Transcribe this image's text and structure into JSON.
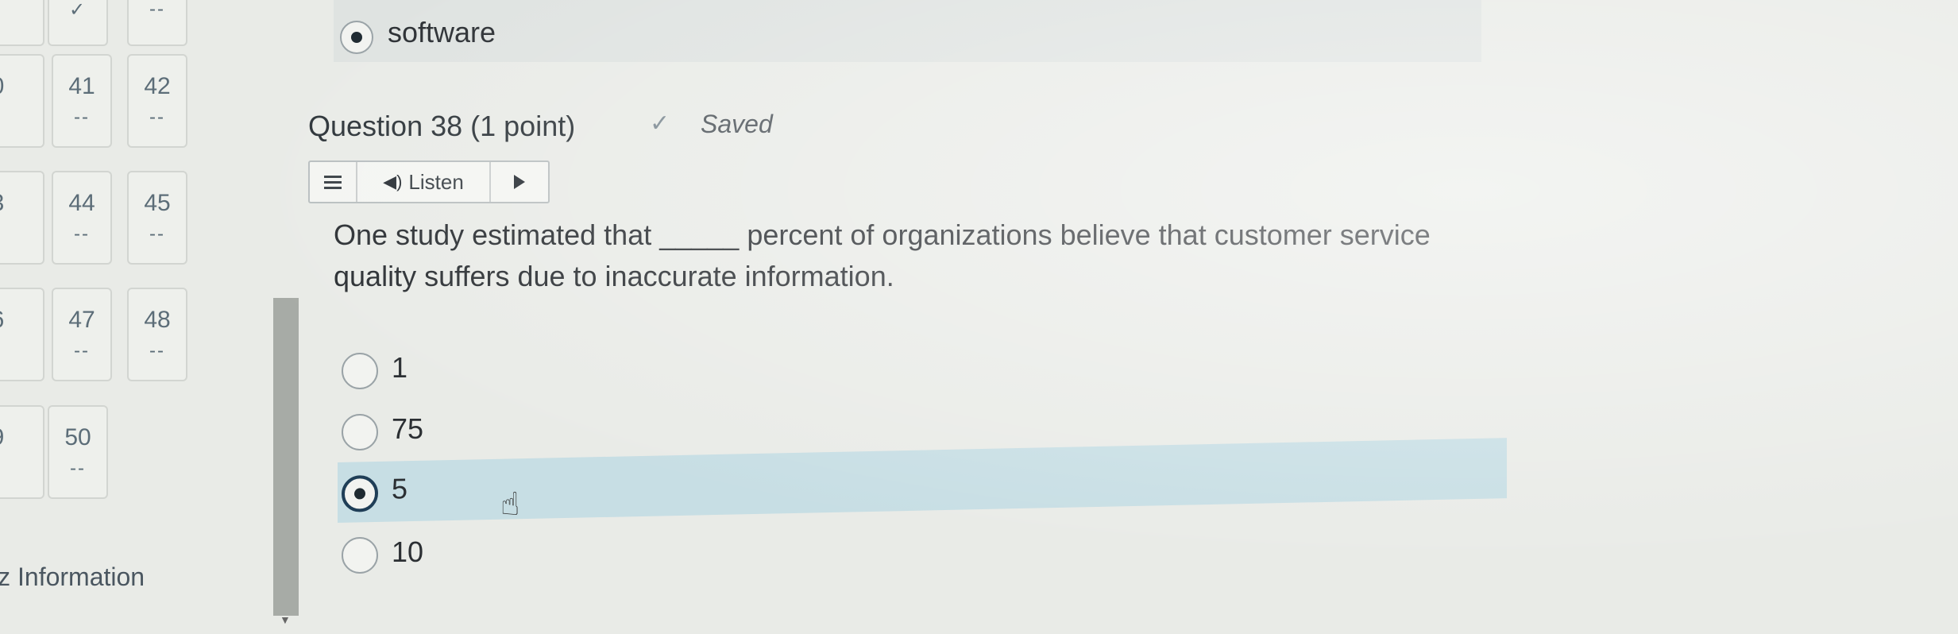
{
  "navigator": {
    "rows": [
      [
        {
          "num": "",
          "ans": "✓"
        },
        {
          "num": "",
          "ans": "✓"
        },
        {
          "num": "",
          "ans": "--"
        }
      ],
      [
        {
          "num": "40",
          "ans": "--"
        },
        {
          "num": "41",
          "ans": "--"
        },
        {
          "num": "42",
          "ans": "--"
        }
      ],
      [
        {
          "num": "43",
          "ans": "--"
        },
        {
          "num": "44",
          "ans": "--"
        },
        {
          "num": "45",
          "ans": "--"
        }
      ],
      [
        {
          "num": "46",
          "ans": "--"
        },
        {
          "num": "47",
          "ans": "--"
        },
        {
          "num": "48",
          "ans": "--"
        }
      ],
      [
        {
          "num": "49",
          "ans": "--"
        },
        {
          "num": "50",
          "ans": "--"
        }
      ]
    ],
    "quiz_info_label": "iz Information"
  },
  "previous_question": {
    "selected_option_label": "software"
  },
  "question": {
    "title": "Question 38 (1 point)",
    "status": "Saved",
    "text": "One study estimated that _____ percent of organizations believe that customer service quality suffers due to inaccurate information.",
    "listen_label": "Listen",
    "options": [
      {
        "label": "1",
        "selected": false
      },
      {
        "label": "75",
        "selected": false
      },
      {
        "label": "5",
        "selected": true
      },
      {
        "label": "10",
        "selected": false
      }
    ]
  },
  "colors": {
    "highlight_row": "#c7dee4",
    "selected_ring": "#1f3e57",
    "background": "#e9ebe7"
  },
  "icons": [
    "check-icon",
    "hamburger-icon",
    "speaker-icon",
    "play-icon",
    "pointer-hand-icon"
  ]
}
